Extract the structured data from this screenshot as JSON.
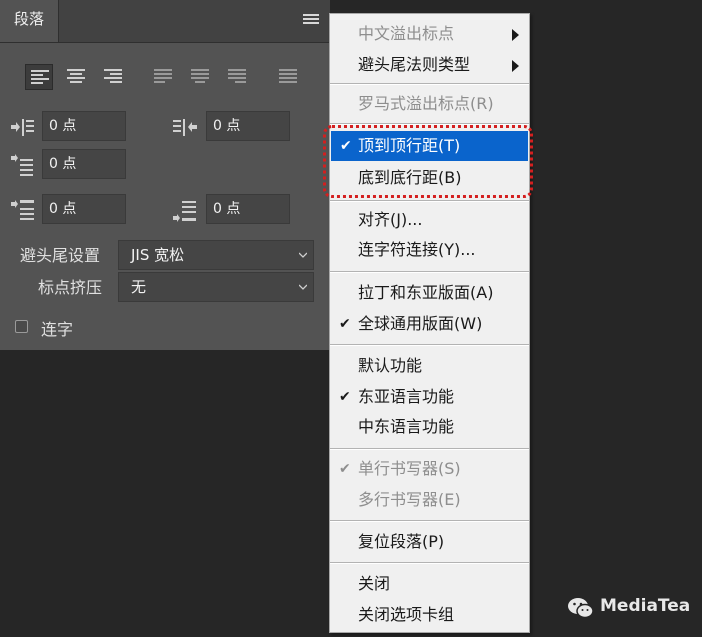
{
  "panel": {
    "tab_label": "段落",
    "indent_left": "0 点",
    "indent_right": "0 点",
    "indent_first_line": "0 点",
    "space_before": "0 点",
    "space_after": "0 点",
    "kinsoku_label": "避头尾设置",
    "kinsoku_value": "JIS 宽松",
    "mojikumi_label": "标点挤压",
    "mojikumi_value": "无",
    "hyphenate_label": "连字"
  },
  "menu": {
    "items": [
      {
        "label": "中文溢出标点",
        "disabled": true,
        "submenu": true
      },
      {
        "label": "避头尾法则类型",
        "submenu": true
      },
      {
        "label": "罗马式溢出标点(R)",
        "disabled": true
      },
      {
        "label": "顶到顶行距(T)",
        "checked": true,
        "highlighted": true
      },
      {
        "label": "底到底行距(B)"
      },
      {
        "label": "对齐(J)..."
      },
      {
        "label": "连字符连接(Y)..."
      },
      {
        "label": "拉丁和东亚版面(A)"
      },
      {
        "label": "全球通用版面(W)",
        "checked": true
      },
      {
        "label": "默认功能"
      },
      {
        "label": "东亚语言功能",
        "checked": true
      },
      {
        "label": "中东语言功能"
      },
      {
        "label": "单行书写器(S)",
        "disabled": true,
        "checked": true
      },
      {
        "label": "多行书写器(E)",
        "disabled": true
      },
      {
        "label": "复位段落(P)"
      },
      {
        "label": "关闭"
      },
      {
        "label": "关闭选项卡组"
      }
    ],
    "check_glyph": "✔",
    "highlight_color": "#0a64cc",
    "callout_color": "#d41f1f"
  },
  "watermark": {
    "text": "MediaTea"
  }
}
